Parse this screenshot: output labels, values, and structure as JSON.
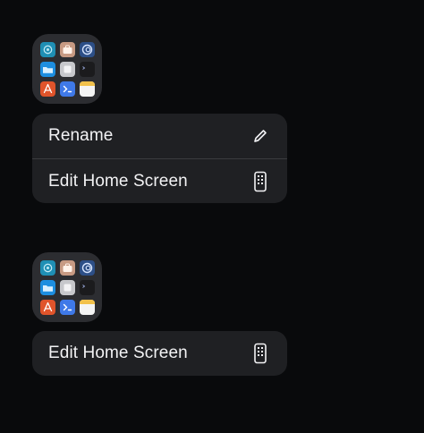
{
  "colors": {
    "background": "#090a0c",
    "menu_background": "#1f2023",
    "folder_background": "#2c2d31",
    "text": "#f2f2f4"
  },
  "groups": [
    {
      "folder_apps": [
        {
          "icon": "ai-assistant-icon",
          "color": "#1f8fb4"
        },
        {
          "icon": "toolbox-icon",
          "color": "#c79a83"
        },
        {
          "icon": "spiral-icon",
          "color": "#2d4f87"
        },
        {
          "icon": "folder-icon",
          "color": "#1d8ee0"
        },
        {
          "icon": "square-app-icon",
          "color": "#c7c8cc"
        },
        {
          "icon": "terminal-icon",
          "color": "#1b1b1d"
        },
        {
          "icon": "app-store-icon",
          "color": "#e0542b"
        },
        {
          "icon": "shortcut-app-icon",
          "color": "#3f79e8"
        },
        {
          "icon": "notes-icon",
          "color": "#f4f4f4"
        }
      ],
      "menu": [
        {
          "label": "Rename",
          "icon": "pencil-icon"
        },
        {
          "label": "Edit Home Screen",
          "icon": "phone-grid-icon"
        }
      ]
    },
    {
      "folder_apps": [
        {
          "icon": "ai-assistant-icon",
          "color": "#1f8fb4"
        },
        {
          "icon": "toolbox-icon",
          "color": "#c79a83"
        },
        {
          "icon": "spiral-icon",
          "color": "#2d4f87"
        },
        {
          "icon": "folder-icon",
          "color": "#1d8ee0"
        },
        {
          "icon": "square-app-icon",
          "color": "#c7c8cc"
        },
        {
          "icon": "terminal-icon",
          "color": "#1b1b1d"
        },
        {
          "icon": "app-store-icon",
          "color": "#e0542b"
        },
        {
          "icon": "shortcut-app-icon",
          "color": "#3f79e8"
        },
        {
          "icon": "notes-icon",
          "color": "#f4f4f4"
        }
      ],
      "menu": [
        {
          "label": "Edit Home Screen",
          "icon": "phone-grid-icon"
        }
      ]
    }
  ]
}
